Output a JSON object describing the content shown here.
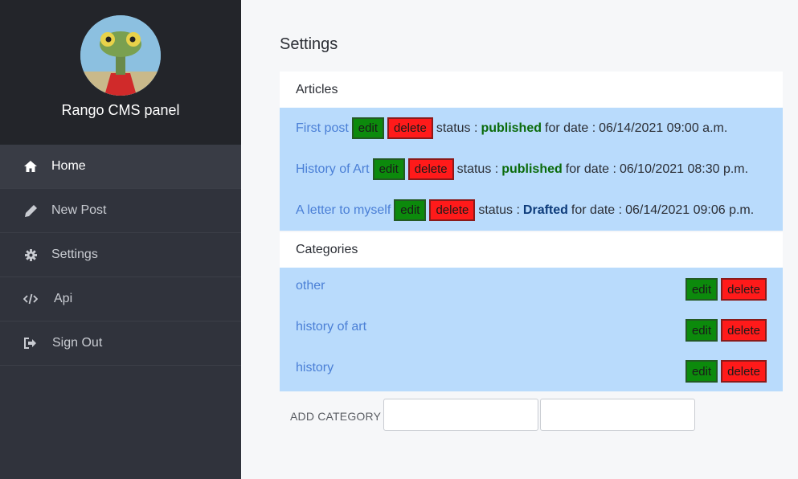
{
  "sidebar": {
    "brand": "Rango CMS panel",
    "nav": [
      {
        "label": "Home",
        "icon": "home-icon"
      },
      {
        "label": "New Post",
        "icon": "pencil-icon"
      },
      {
        "label": "Settings",
        "icon": "gear-icon"
      },
      {
        "label": "Api",
        "icon": "code-icon"
      },
      {
        "label": "Sign Out",
        "icon": "sign-out-icon"
      }
    ]
  },
  "main": {
    "title": "Settings",
    "articles": {
      "header": "Articles",
      "status_label": "status :",
      "date_label": "for date :",
      "edit_label": "edit",
      "delete_label": "delete",
      "items": [
        {
          "title": "First post",
          "status": "published",
          "date": "06/14/2021 09:00 a.m."
        },
        {
          "title": "History of Art",
          "status": "published",
          "date": "06/10/2021 08:30 p.m."
        },
        {
          "title": "A letter to myself",
          "status": "Drafted",
          "date": "06/14/2021 09:06 p.m."
        }
      ]
    },
    "categories": {
      "header": "Categories",
      "edit_label": "edit",
      "delete_label": "delete",
      "items": [
        "other",
        "history of art",
        "history"
      ]
    },
    "add_category": {
      "label": "ADD CATEGORY",
      "input1_value": "",
      "input2_value": ""
    }
  },
  "colors": {
    "sidebar_bg": "#30333c",
    "profile_bg": "#23252a",
    "row_bg": "#b9dbfc",
    "link": "#4a7fd6",
    "edit_btn": "#0c8a0c",
    "delete_btn": "#ff1a1a",
    "published": "#0b6b0b",
    "drafted": "#0d3b7a"
  }
}
